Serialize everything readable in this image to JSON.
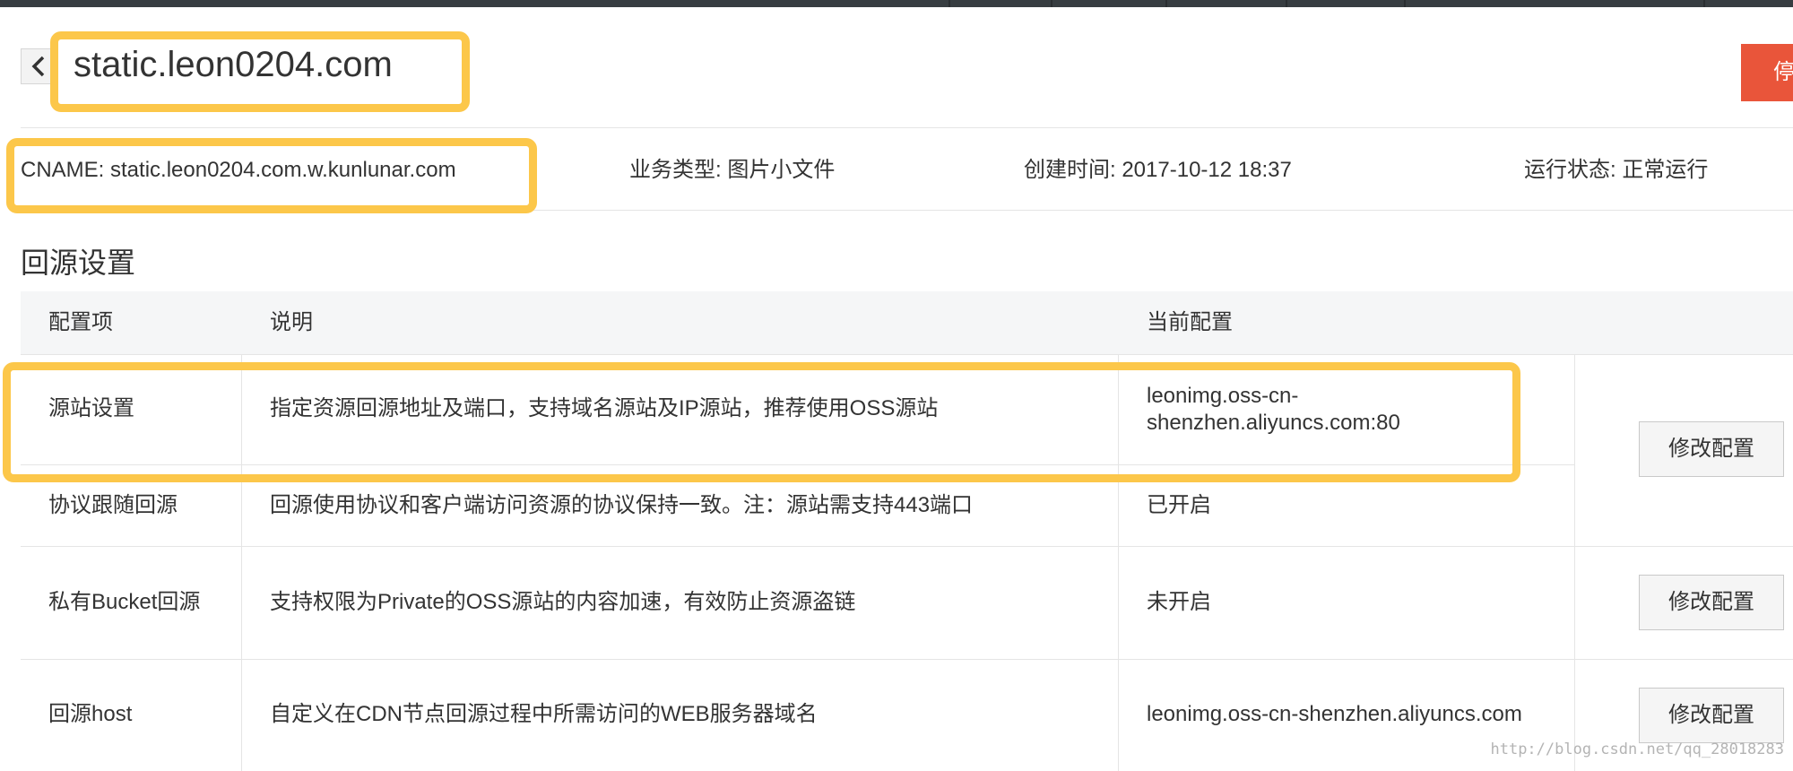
{
  "header": {
    "domain": "static.leon0204.com",
    "stop_label": "停"
  },
  "info": {
    "cname": "CNAME: static.leon0204.com.w.kunlunar.com",
    "business_type": "业务类型: 图片小文件",
    "created": "创建时间: 2017-10-12 18:37",
    "status": "运行状态: 正常运行"
  },
  "section": {
    "title": "回源设置"
  },
  "table": {
    "headers": [
      "配置项",
      "说明",
      "当前配置"
    ],
    "rows": [
      {
        "label": "源站设置",
        "desc": "指定资源回源地址及端口，支持域名源站及IP源站，推荐使用OSS源站",
        "value_line1": "leonimg.oss-cn-",
        "value_line2": "shenzhen.aliyuncs.com:80",
        "value_color": "#1a9c1a"
      },
      {
        "label": "协议跟随回源",
        "desc": "回源使用协议和客户端访问资源的协议保持一致。注：源站需支持443端口",
        "value": "已开启",
        "value_color": "#1a9c1a"
      },
      {
        "label": "私有Bucket回源",
        "desc": "支持权限为Private的OSS源站的内容加速，有效防止资源盗链",
        "value": "未开启",
        "value_color": "#f7941d"
      },
      {
        "label": "回源host",
        "desc": "自定义在CDN节点回源过程中所需访问的WEB服务器域名",
        "value": "leonimg.oss-cn-shenzhen.aliyuncs.com",
        "value_color": "#1a9c1a"
      }
    ],
    "edit_label": "修改配置"
  },
  "watermark": "http://blog.csdn.net/qq_28018283",
  "colors": {
    "highlight": "#fcc74a",
    "stop_button": "#e9553a",
    "topbar": "#373d41"
  }
}
